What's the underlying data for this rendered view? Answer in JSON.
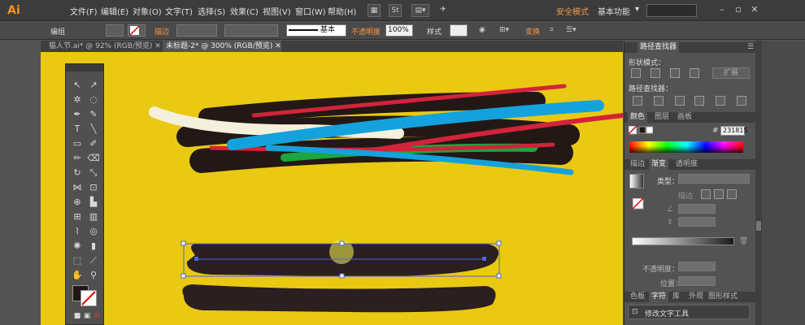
{
  "app": {
    "logo": "Ai"
  },
  "menu": [
    "文件(F)",
    "编辑(E)",
    "对象(O)",
    "文字(T)",
    "选择(S)",
    "效果(C)",
    "视图(V)",
    "窗口(W)",
    "帮助(H)"
  ],
  "menubar": {
    "st_label": "St",
    "safe_mode": "安全模式",
    "workspace": "基本功能"
  },
  "control": {
    "selection": "编组",
    "stroke_label": "描边",
    "stroke_profile": "基本",
    "opacity_label": "不透明度",
    "opacity_value": "100%",
    "style_label": "样式",
    "transform_label": "变换"
  },
  "tabs": [
    {
      "label": "猫人节.ai* @ 92% (RGB/预览)",
      "active": false
    },
    {
      "label": "未标题-2* @ 300% (RGB/预览)",
      "active": true
    }
  ],
  "panels": {
    "pathfinder": {
      "tab": "路径查找器",
      "shape_modes": "形状模式：",
      "expand": "扩展",
      "pathfinders": "路径查找器："
    },
    "color_tabs": [
      "颜色",
      "图层",
      "画板"
    ],
    "hex_symbol": "#",
    "hex_value": "231815",
    "gradient_tabs": [
      "描边",
      "渐变",
      "透明度"
    ],
    "gradient": {
      "type_label": "类型：",
      "stroke_label": "描边",
      "opacity_label": "不透明度：",
      "location_label": "位置："
    },
    "bottom_tabs": [
      "色板",
      "字符",
      "库",
      "外观",
      "图形样式"
    ],
    "char_style_item": "修改文字工具"
  },
  "colors": {
    "canvas": "#eac913",
    "dark_stroke": "#231815",
    "red": "#d3233b",
    "blue": "#14a2dd",
    "green": "#1ba63e",
    "cream": "#f5f0dc",
    "accent_orange": "#f7931e"
  }
}
